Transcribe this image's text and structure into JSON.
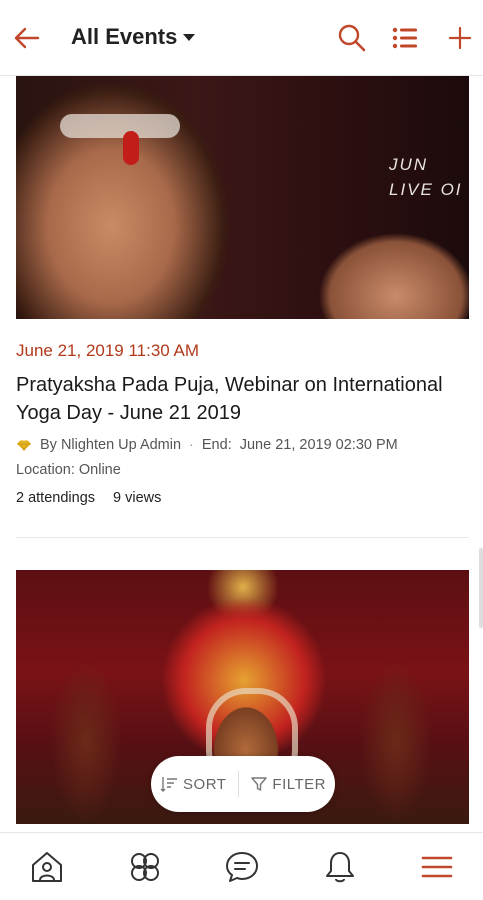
{
  "header": {
    "title": "All Events",
    "accent": "#c0472a"
  },
  "events": [
    {
      "image_overlay_lines": [
        "JUN",
        "LIVE OI"
      ],
      "date": "June 21, 2019 11:30 AM",
      "title": "Pratyaksha Pada Puja, Webinar on International Yoga Day - June 21 2019",
      "author": "By Nlighten Up Admin",
      "end_label": "End:",
      "end_time": "June 21, 2019 02:30 PM",
      "location": "Location: Online",
      "attendings": "2 attendings",
      "views": "9 views"
    }
  ],
  "controls": {
    "sort_label": "SORT",
    "filter_label": "FILTER"
  },
  "icons": {
    "back": "arrow-left-icon",
    "search": "search-icon",
    "list": "list-icon",
    "add": "plus-icon",
    "badge": "gem-badge-icon"
  },
  "bottom_nav": [
    "home-icon",
    "groups-icon",
    "messages-icon",
    "notifications-icon",
    "menu-icon"
  ]
}
